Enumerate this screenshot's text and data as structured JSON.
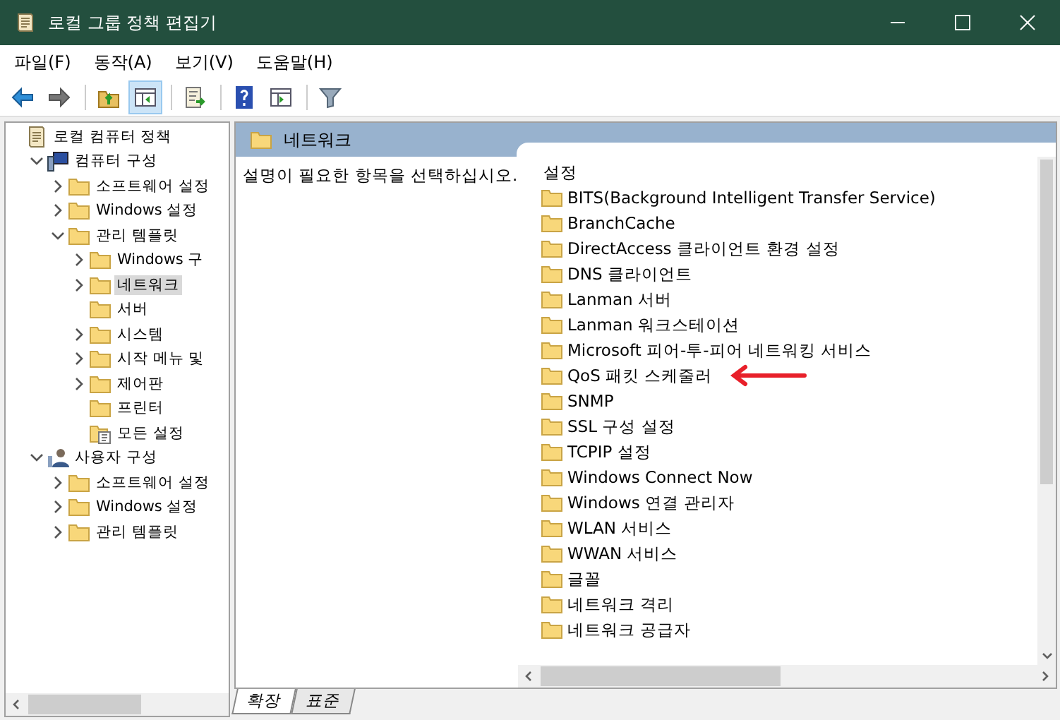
{
  "window": {
    "title": "로컬 그룹 정책 편집기"
  },
  "menu": [
    "파일(F)",
    "동작(A)",
    "보기(V)",
    "도움말(H)"
  ],
  "toolbar": [
    {
      "kind": "back"
    },
    {
      "kind": "forward"
    },
    {
      "kind": "sep"
    },
    {
      "kind": "up"
    },
    {
      "kind": "panel",
      "selected": true
    },
    {
      "kind": "sep"
    },
    {
      "kind": "export"
    },
    {
      "kind": "sep"
    },
    {
      "kind": "help"
    },
    {
      "kind": "panel2",
      "selected": false
    },
    {
      "kind": "sep"
    },
    {
      "kind": "filter"
    }
  ],
  "tree": [
    {
      "label": "로컬 컴퓨터 정책",
      "kind": "policy",
      "selected": false,
      "children": [
        {
          "label": "컴퓨터 구성",
          "kind": "computer",
          "expanded": true,
          "selected": false,
          "children": [
            {
              "label": "소프트웨어 설정",
              "kind": "folder",
              "expanded": false,
              "selected": false
            },
            {
              "label": "Windows 설정",
              "kind": "folder",
              "expanded": false,
              "selected": false
            },
            {
              "label": "관리 템플릿",
              "kind": "folder",
              "expanded": true,
              "selected": false,
              "children": [
                {
                  "label": "Windows 구",
                  "kind": "folder",
                  "expanded": false,
                  "selected": false
                },
                {
                  "label": "네트워크",
                  "kind": "folder",
                  "expanded": false,
                  "selected": true
                },
                {
                  "label": "서버",
                  "kind": "folder",
                  "selected": false
                },
                {
                  "label": "시스템",
                  "kind": "folder",
                  "expanded": false,
                  "selected": false
                },
                {
                  "label": "시작 메뉴 및",
                  "kind": "folder",
                  "expanded": false,
                  "selected": false
                },
                {
                  "label": "제어판",
                  "kind": "folder",
                  "expanded": false,
                  "selected": false
                },
                {
                  "label": "프린터",
                  "kind": "folder",
                  "selected": false
                },
                {
                  "label": "모든 설정",
                  "kind": "settings-doc",
                  "selected": false
                }
              ]
            }
          ]
        },
        {
          "label": "사용자 구성",
          "kind": "user",
          "expanded": true,
          "selected": false,
          "children": [
            {
              "label": "소프트웨어 설정",
              "kind": "folder",
              "expanded": false,
              "selected": false
            },
            {
              "label": "Windows 설정",
              "kind": "folder",
              "expanded": false,
              "selected": false
            },
            {
              "label": "관리 템플릿",
              "kind": "folder",
              "expanded": false,
              "selected": false
            }
          ]
        }
      ]
    }
  ],
  "panel": {
    "title": "네트워크",
    "description": "설명이 필요한 항목을 선택하십시오.",
    "column": "설정",
    "items": [
      {
        "label": "BITS(Background Intelligent Transfer Service)",
        "marked": false
      },
      {
        "label": "BranchCache",
        "marked": false
      },
      {
        "label": "DirectAccess 클라이언트 환경 설정",
        "marked": false
      },
      {
        "label": "DNS 클라이언트",
        "marked": false
      },
      {
        "label": "Lanman 서버",
        "marked": false
      },
      {
        "label": "Lanman 워크스테이션",
        "marked": false
      },
      {
        "label": "Microsoft 피어-투-피어 네트워킹 서비스",
        "marked": false
      },
      {
        "label": "QoS 패킷 스케줄러",
        "marked": true
      },
      {
        "label": "SNMP",
        "marked": false
      },
      {
        "label": "SSL 구성 설정",
        "marked": false
      },
      {
        "label": "TCPIP 설정",
        "marked": false
      },
      {
        "label": "Windows Connect Now",
        "marked": false
      },
      {
        "label": "Windows 연결 관리자",
        "marked": false
      },
      {
        "label": "WLAN 서비스",
        "marked": false
      },
      {
        "label": "WWAN 서비스",
        "marked": false
      },
      {
        "label": "글꼴",
        "marked": false
      },
      {
        "label": "네트워크 격리",
        "marked": false
      },
      {
        "label": "네트워크 공급자",
        "marked": false
      }
    ]
  },
  "tabs": [
    {
      "label": "확장",
      "selected": true
    },
    {
      "label": "표준",
      "selected": false
    }
  ]
}
